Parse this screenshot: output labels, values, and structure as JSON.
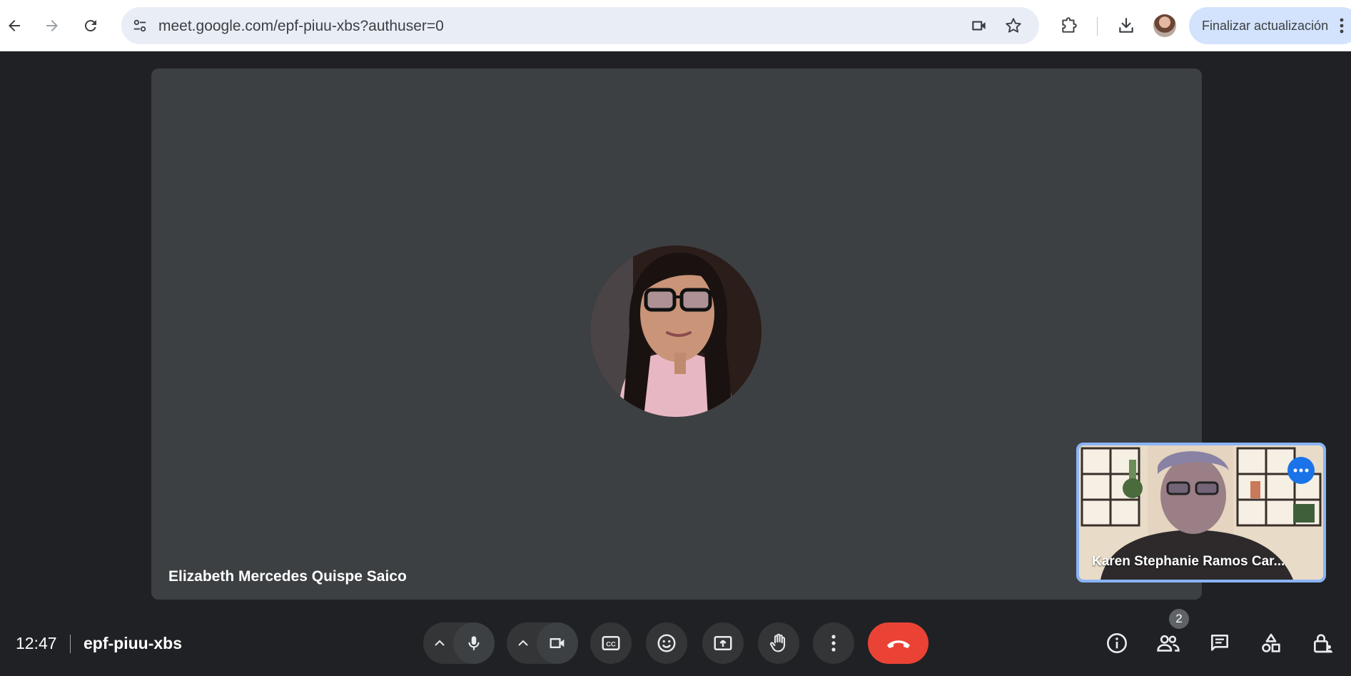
{
  "browser": {
    "url": "meet.google.com/epf-piuu-xbs?authuser=0",
    "update_button_label": "Finalizar actualización",
    "icons": {
      "back": "arrow-left-icon",
      "forward": "arrow-right-icon",
      "reload": "reload-icon",
      "site_info": "tune-icon",
      "camera": "video-camera-icon",
      "bookmark": "star-icon",
      "extensions": "puzzle-icon",
      "downloads": "download-icon",
      "menu": "kebab-icon"
    }
  },
  "meeting": {
    "main_participant_name": "Elizabeth Mercedes Quispe Saico",
    "self_tile_name": "Karen Stephanie Ramos Car...",
    "clock": "12:47",
    "code": "epf-piuu-xbs",
    "participants_count": "2"
  },
  "colors": {
    "background": "#202124",
    "tile": "#3c4043",
    "end_call": "#ea4335",
    "self_tile_border": "#8ab4f8",
    "accent_blue": "#1a73e8"
  }
}
